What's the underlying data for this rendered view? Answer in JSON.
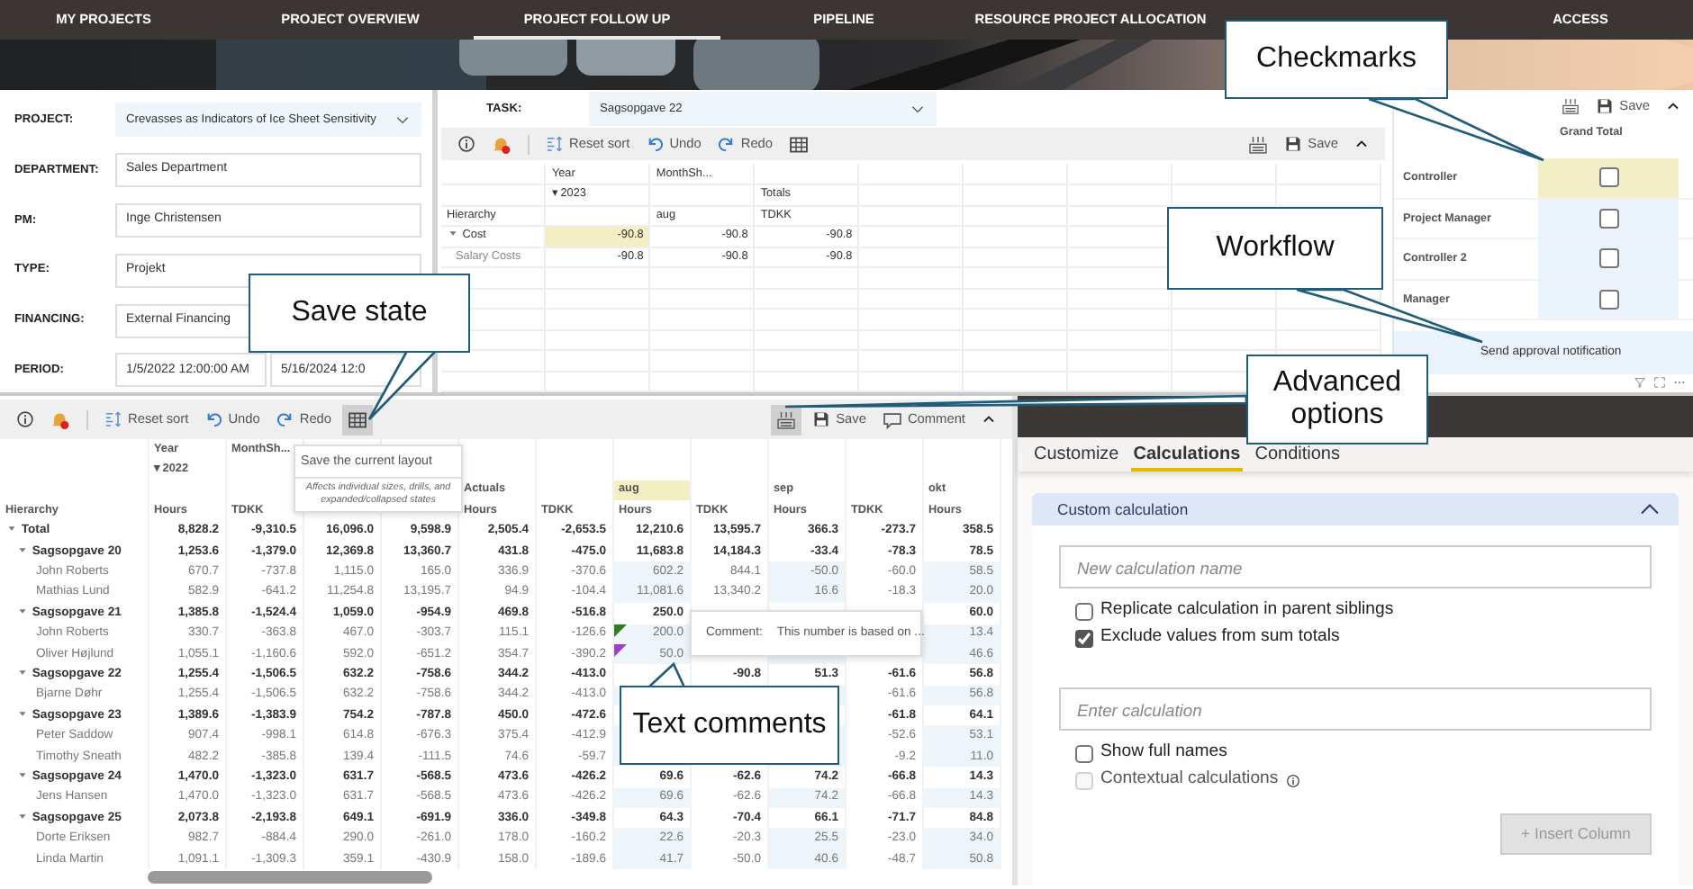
{
  "nav": [
    {
      "label": "MY PROJECTS",
      "selected": false
    },
    {
      "label": "PROJECT OVERVIEW",
      "selected": false
    },
    {
      "label": "PROJECT FOLLOW UP",
      "selected": true
    },
    {
      "label": "PIPELINE",
      "selected": false
    },
    {
      "label": "RESOURCE PROJECT ALLOCATION",
      "selected": false
    },
    {
      "label": "ACCESS",
      "selected": false
    }
  ],
  "form": [
    {
      "label": "PROJECT:",
      "kind": "dropdown",
      "value": "Crevasses as Indicators of Ice Sheet Sensitivity"
    },
    {
      "label": "DEPARTMENT:",
      "kind": "text",
      "value": "Sales Department"
    },
    {
      "label": "PM:",
      "kind": "text",
      "value": "Inge Christensen"
    },
    {
      "label": "TYPE:",
      "kind": "text",
      "value": "Projekt"
    },
    {
      "label": "FINANCING:",
      "kind": "text",
      "value": "External Financing"
    },
    {
      "label": "PERIOD:",
      "kind": "range",
      "values": [
        "1/5/2022 12:00:00 AM",
        "5/16/2024 12:0"
      ]
    }
  ],
  "task": {
    "label": "TASK:",
    "value": "Sagsopgave 22"
  },
  "task_toolbar": {
    "buttons": [
      "Reset sort",
      "Undo",
      "Redo"
    ],
    "save": "Save",
    "grid_hovered": false,
    "options_hovered": false
  },
  "task_table": {
    "header_rows": [
      [
        null,
        "Year",
        "MonthSh...",
        null
      ],
      [
        null,
        "▾ 2023",
        null,
        "Totals"
      ],
      [
        "Hierarchy",
        null,
        "aug",
        "TDKK"
      ]
    ],
    "rows": [
      {
        "label": "Cost",
        "kind": "group",
        "expanded": true,
        "cells": [
          {
            "text": "-90.8",
            "highlighted": true
          },
          "-90.8",
          "-90.8"
        ]
      },
      {
        "label": "Salary Costs",
        "kind": "member",
        "cells": [
          "-90.8",
          "-90.8",
          "-90.8"
        ]
      }
    ]
  },
  "workflow": {
    "save": "Save",
    "header": "Grand Total",
    "rows": [
      {
        "label": "Controller",
        "highlighted": true,
        "checked": false
      },
      {
        "label": "Project Manager",
        "highlighted": false,
        "checked": false
      },
      {
        "label": "Controller 2",
        "highlighted": false,
        "checked": false
      },
      {
        "label": "Manager",
        "highlighted": false,
        "checked": false
      }
    ],
    "action": "Send approval notification"
  },
  "pivot_toolbar": {
    "buttons": [
      "Reset sort",
      "Undo",
      "Redo"
    ],
    "save": "Save",
    "comment": "Comment",
    "grid_hovered": true,
    "options_hovered": true
  },
  "pivot": {
    "header_rows": [
      [
        null,
        "Year",
        "MonthSh...",
        null,
        null,
        null,
        null,
        null,
        null,
        null,
        null,
        null
      ],
      [
        null,
        "▾ 2022",
        null,
        null,
        null,
        null,
        null,
        null,
        null,
        null,
        null,
        null
      ],
      [
        null,
        null,
        null,
        null,
        null,
        "Actuals",
        null,
        {
          "text": "aug",
          "highlighted": true
        },
        null,
        "sep",
        null,
        "okt"
      ],
      [
        "Hierarchy",
        "Hours",
        "TDKK",
        null,
        null,
        "Hours",
        "TDKK",
        "Hours",
        "TDKK",
        "Hours",
        "TDKK",
        "Hours"
      ]
    ],
    "column_editable": [
      false,
      false,
      false,
      false,
      false,
      false,
      true,
      false,
      true,
      false,
      true
    ],
    "rows": [
      {
        "label": "Total",
        "kind": "total",
        "expanded": true,
        "cells": [
          "8,828.2",
          "-9,310.5",
          "16,096.0",
          "9,598.9",
          "2,505.4",
          "-2,653.5",
          "12,210.6",
          "13,595.7",
          "366.3",
          "-273.7",
          "358.5"
        ]
      },
      {
        "label": "Sagsopgave 20",
        "kind": "group",
        "expanded": true,
        "cells": [
          "1,253.6",
          "-1,379.0",
          "12,369.8",
          "13,360.7",
          "431.8",
          "-475.0",
          "11,683.8",
          "14,184.3",
          "-33.4",
          "-78.3",
          "78.5"
        ]
      },
      {
        "label": "John Roberts",
        "kind": "member",
        "cells": [
          "670.7",
          "-737.8",
          "1,115.0",
          "165.0",
          "336.9",
          "-370.6",
          "602.2",
          "844.1",
          "-50.0",
          "-60.0",
          "58.5"
        ]
      },
      {
        "label": "Mathias Lund",
        "kind": "member",
        "cells": [
          "582.9",
          "-641.2",
          "11,254.8",
          "13,195.7",
          "94.9",
          "-104.4",
          "11,081.6",
          "13,340.2",
          "16.6",
          "-18.3",
          "20.0"
        ]
      },
      {
        "label": "Sagsopgave 21",
        "kind": "group",
        "expanded": true,
        "cells": [
          "1,385.8",
          "-1,524.4",
          "1,059.0",
          "-954.9",
          "469.8",
          "-516.8",
          "250.0",
          null,
          null,
          null,
          "60.0"
        ]
      },
      {
        "label": "John Roberts",
        "kind": "member",
        "cells": [
          "330.7",
          "-363.8",
          "467.0",
          "-303.7",
          "115.1",
          "-126.6",
          {
            "text": "200.0",
            "color": "#2e7d1e"
          },
          null,
          null,
          null,
          "13.4"
        ]
      },
      {
        "label": "Oliver Højlund",
        "kind": "member",
        "cells": [
          "1,055.1",
          "-1,160.6",
          "592.0",
          "-651.2",
          "354.7",
          "-390.2",
          {
            "text": "50.0",
            "color": "#9b3fd1"
          },
          null,
          null,
          null,
          "46.6"
        ]
      },
      {
        "label": "Sagsopgave 22",
        "kind": "group",
        "expanded": true,
        "cells": [
          "1,255.4",
          "-1,506.5",
          "632.2",
          "-758.6",
          "344.2",
          "-413.0",
          null,
          "-90.8",
          "51.3",
          "-61.6",
          "56.8"
        ]
      },
      {
        "label": "Bjarne Døhr",
        "kind": "member",
        "cells": [
          "1,255.4",
          "-1,506.5",
          "632.2",
          "-758.6",
          "344.2",
          "-413.0",
          null,
          null,
          null,
          "-61.6",
          "56.8"
        ]
      },
      {
        "label": "Sagsopgave 23",
        "kind": "group",
        "expanded": true,
        "cells": [
          "1,389.6",
          "-1,383.9",
          "754.2",
          "-787.8",
          "450.0",
          "-472.6",
          null,
          null,
          null,
          "-61.8",
          "64.1"
        ]
      },
      {
        "label": "Peter Saddow",
        "kind": "member",
        "cells": [
          "907.4",
          "-998.1",
          "614.8",
          "-676.3",
          "375.4",
          "-412.9",
          null,
          null,
          null,
          "-52.6",
          "53.1"
        ]
      },
      {
        "label": "Timothy Sneath",
        "kind": "member",
        "cells": [
          "482.2",
          "-385.8",
          "139.4",
          "-111.5",
          "74.6",
          "-59.7",
          null,
          null,
          null,
          "-9.2",
          "11.0"
        ]
      },
      {
        "label": "Sagsopgave 24",
        "kind": "group",
        "expanded": true,
        "cells": [
          "1,470.0",
          "-1,323.0",
          "631.7",
          "-568.5",
          "473.6",
          "-426.2",
          "69.6",
          "-62.6",
          "74.2",
          "-66.8",
          "14.3"
        ]
      },
      {
        "label": "Jens Hansen",
        "kind": "member",
        "cells": [
          "1,470.0",
          "-1,323.0",
          "631.7",
          "-568.5",
          "473.6",
          "-426.2",
          "69.6",
          "-62.6",
          "74.2",
          "-66.8",
          "14.3"
        ]
      },
      {
        "label": "Sagsopgave 25",
        "kind": "group",
        "expanded": true,
        "cells": [
          "2,073.8",
          "-2,193.8",
          "649.1",
          "-691.9",
          "336.0",
          "-349.8",
          "64.3",
          "-70.4",
          "66.1",
          "-71.7",
          "84.8"
        ]
      },
      {
        "label": "Dorte Eriksen",
        "kind": "member",
        "cells": [
          "982.7",
          "-884.4",
          "290.0",
          "-261.0",
          "178.0",
          "-160.2",
          "22.6",
          "-20.3",
          "25.5",
          "-23.0",
          "34.0"
        ]
      },
      {
        "label": "Linda Martin",
        "kind": "member",
        "cells": [
          "1,091.1",
          "-1,309.3",
          "359.1",
          "-430.9",
          "158.0",
          "-189.6",
          "41.7",
          "-50.0",
          "40.6",
          "-48.7",
          "50.8"
        ]
      }
    ]
  },
  "layout_tooltip": {
    "title": "Save the current layout",
    "note": "Affects individual sizes, drills, and expanded/collapsed states"
  },
  "comment_tooltip": {
    "label": "Comment:",
    "text": "This number is based on ..."
  },
  "advanced_panel": {
    "tabs": [
      {
        "label": "Customize",
        "selected": false
      },
      {
        "label": "Calculations",
        "selected": true
      },
      {
        "label": "Conditions",
        "selected": false
      }
    ],
    "section": {
      "title": "Custom calculation",
      "expanded": true
    },
    "name_field": {
      "placeholder": "New calculation name"
    },
    "options": [
      {
        "label": "Replicate calculation in parent siblings",
        "checked": false,
        "disabled": false
      },
      {
        "label": "Exclude values from sum totals",
        "checked": true,
        "disabled": false
      }
    ],
    "formula_field": {
      "placeholder": "Enter calculation"
    },
    "options_2": [
      {
        "label": "Show full names",
        "checked": false,
        "disabled": false
      },
      {
        "label": "Contextual calculations",
        "checked": false,
        "disabled": true
      }
    ],
    "insert_button": {
      "label": "+ Insert Column",
      "disabled": true
    }
  },
  "callouts": [
    {
      "text": "Checkmarks"
    },
    {
      "text": "Workflow"
    },
    {
      "text": "Save state"
    },
    {
      "text": "Advanced options"
    },
    {
      "text": "Text comments"
    }
  ]
}
